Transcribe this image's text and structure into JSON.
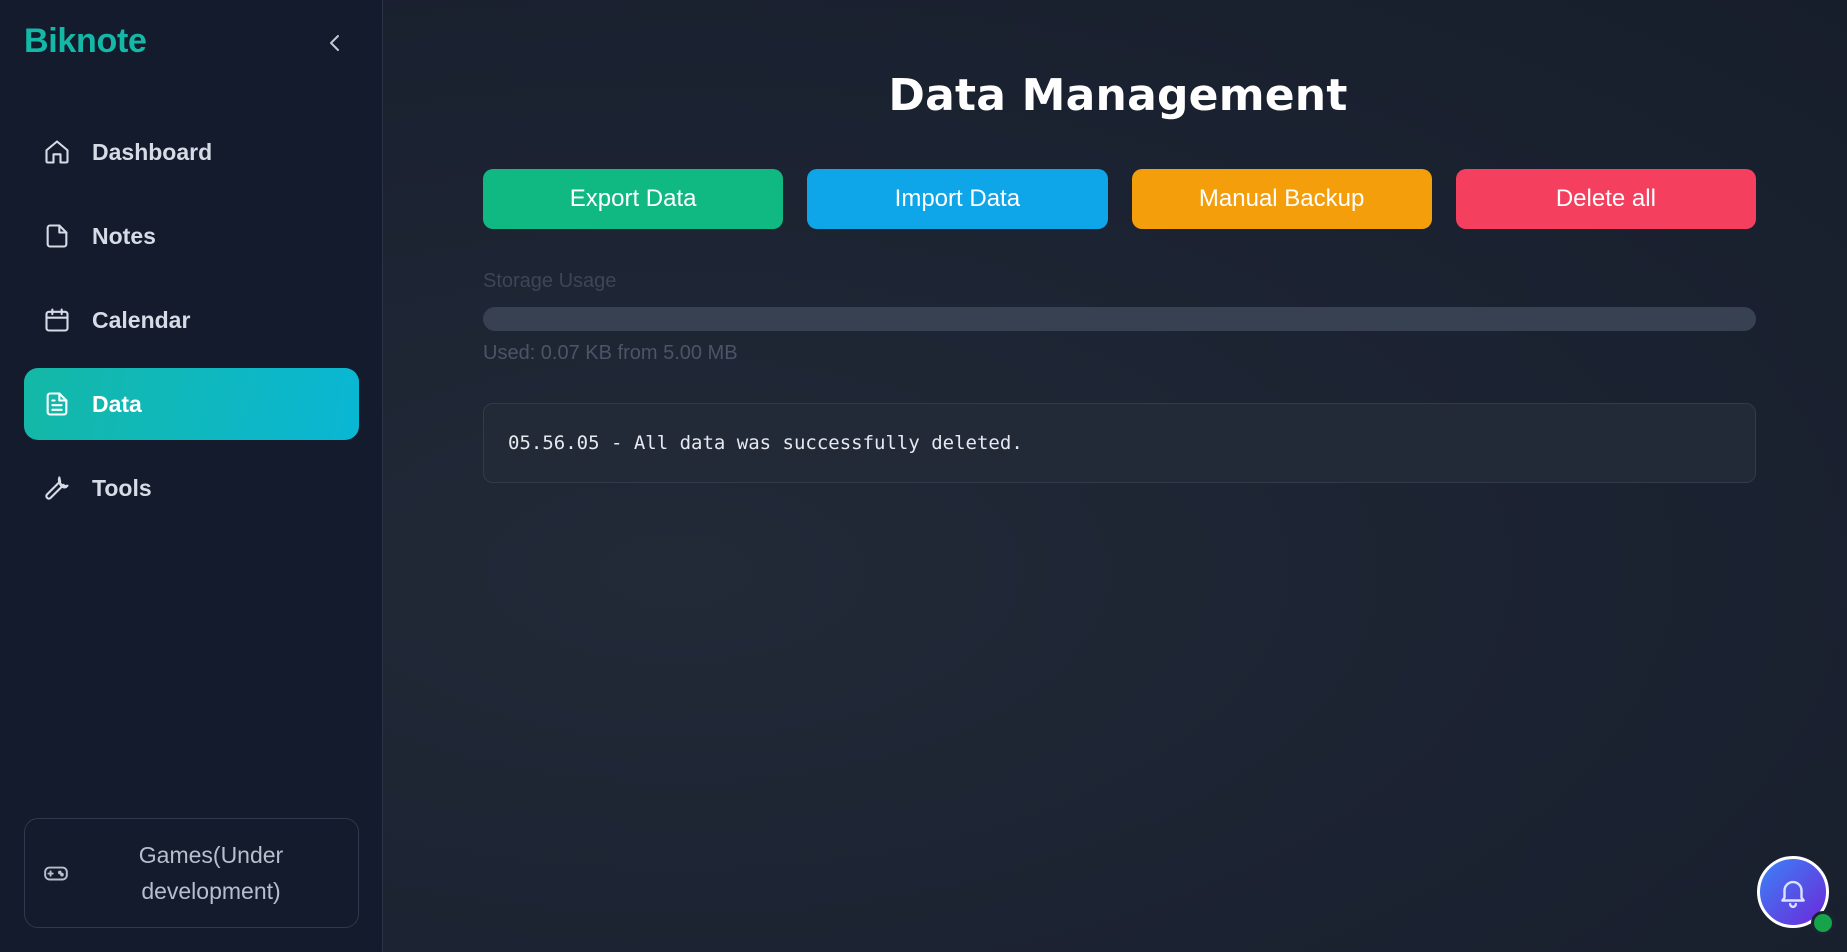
{
  "sidebar": {
    "brand": "Biknote",
    "items": [
      {
        "label": "Dashboard",
        "icon": "home-icon"
      },
      {
        "label": "Notes",
        "icon": "file-icon"
      },
      {
        "label": "Calendar",
        "icon": "calendar-icon"
      },
      {
        "label": "Data",
        "icon": "document-icon",
        "active": true
      },
      {
        "label": "Tools",
        "icon": "wrench-icon"
      }
    ],
    "games": {
      "label": "Games(Under development)",
      "icon": "gamepad-icon"
    }
  },
  "main": {
    "title": "Data Management",
    "actions": {
      "export_label": "Export Data",
      "import_label": "Import Data",
      "backup_label": "Manual Backup",
      "delete_label": "Delete all"
    },
    "storage": {
      "label": "Storage Usage",
      "used_text": "Used: 0.07 KB from 5.00 MB",
      "fill_fraction": 0.0
    },
    "log": {
      "message": "05.56.05 - All data was successfully deleted."
    }
  },
  "notification": {
    "icon": "bell-icon",
    "status": "online"
  },
  "colors": {
    "brand": "#14b8a6",
    "export": "#10b981",
    "import": "#0ea5e9",
    "backup": "#f59e0b",
    "delete": "#f43f5e"
  }
}
